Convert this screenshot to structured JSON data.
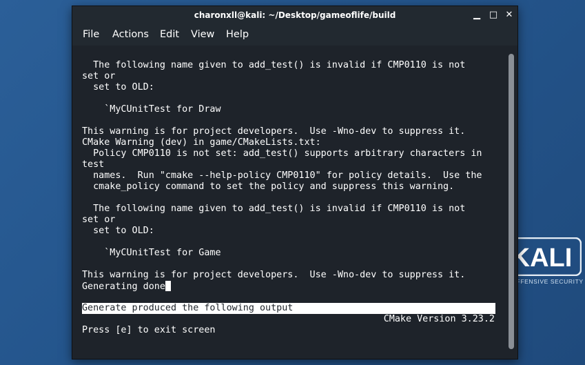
{
  "desktop": {
    "logo_text": "KALI",
    "logo_subtext": "BY OFFENSIVE SECURITY",
    "background_color": "#2b5f98"
  },
  "window": {
    "title": "charonxll@kali: ~/Desktop/gameoflife/build",
    "buttons": {
      "minimize": "▁",
      "maximize": "□",
      "close": "✕"
    }
  },
  "menu": {
    "items": [
      {
        "label": "File"
      },
      {
        "label": "Actions"
      },
      {
        "label": "Edit"
      },
      {
        "label": "View"
      },
      {
        "label": "Help"
      }
    ]
  },
  "terminal": {
    "lines": [
      "  The following name given to add_test() is invalid if CMP0110 is not",
      "set or",
      "  set to OLD:",
      "",
      "    `MyCUnitTest for Draw",
      "",
      "This warning is for project developers.  Use -Wno-dev to suppress it.",
      "CMake Warning (dev) in game/CMakeLists.txt:",
      "  Policy CMP0110 is not set: add_test() supports arbitrary characters in",
      "test",
      "  names.  Run \"cmake --help-policy CMP0110\" for policy details.  Use the",
      "  cmake_policy command to set the policy and suppress this warning.",
      "",
      "  The following name given to add_test() is invalid if CMP0110 is not",
      "set or",
      "  set to OLD:",
      "",
      "    `MyCUnitTest for Game",
      "",
      "This warning is for project developers.  Use -Wno-dev to suppress it.",
      "Generating done"
    ],
    "highlight": "Generate produced the following output",
    "version": "CMake Version 3.23.2",
    "prompt": "Press [e] to exit screen"
  }
}
